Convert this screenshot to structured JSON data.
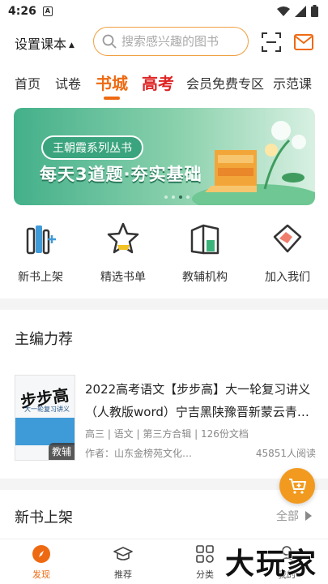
{
  "status_bar": {
    "time": "4:26",
    "notification_letter": "A"
  },
  "header": {
    "course_select_label": "设置课本",
    "search_placeholder": "搜索感兴趣的图书"
  },
  "tabs": [
    {
      "label": "首页"
    },
    {
      "label": "试卷"
    },
    {
      "label": "书城"
    },
    {
      "label": "高考"
    },
    {
      "label": "会员免费专区"
    },
    {
      "label": "示范课"
    }
  ],
  "banner": {
    "pill_text": "王朝霞系列丛书",
    "headline": "每天3道题·夯实基础"
  },
  "quick_links": [
    {
      "label": "新书上架",
      "icon": "new-books-icon"
    },
    {
      "label": "精选书单",
      "icon": "star-list-icon"
    },
    {
      "label": "教辅机构",
      "icon": "institution-icon"
    },
    {
      "label": "加入我们",
      "icon": "handshake-icon"
    }
  ],
  "editor_picks": {
    "title": "主编力荐",
    "book": {
      "cover_title": "步步高",
      "cover_subtitle": "大一轮复习讲义",
      "cover_tag": "教辅",
      "title": "2022高考语文【步步高】大一轮复习讲义（人教版word）宁吉黑陕豫晋新蒙云青…",
      "meta": "高三 | 语文 | 第三方合辑 | 126份文档",
      "author": "作者：山东金榜苑文化…",
      "reads": "45851人阅读"
    }
  },
  "new_books": {
    "title": "新书上架",
    "see_all": "全部"
  },
  "bottom_nav": [
    {
      "label": "发现",
      "icon": "discover-icon"
    },
    {
      "label": "推荐",
      "icon": "graduation-cap-icon"
    },
    {
      "label": "分类",
      "icon": "category-grid-icon"
    },
    {
      "label": "我的",
      "icon": "profile-icon"
    }
  ],
  "watermark": "大玩家",
  "colors": {
    "accent": "#ee6a12",
    "hot": "#e02424",
    "cart": "#f29a1f"
  }
}
